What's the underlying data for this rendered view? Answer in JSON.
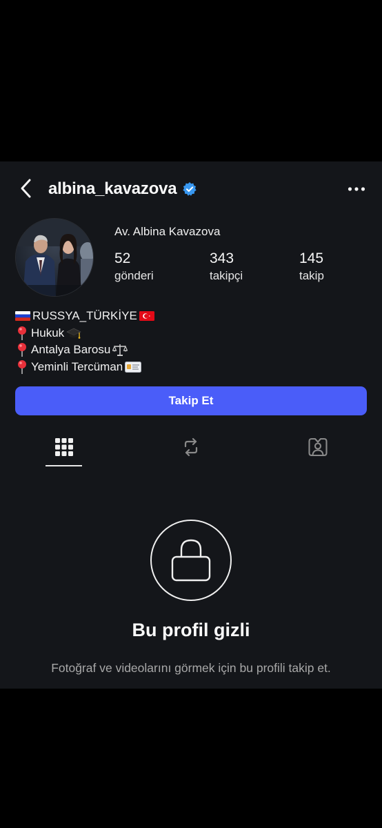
{
  "header": {
    "username": "albina_kavazova",
    "verified": true,
    "back_icon": "chevron-left-icon",
    "more_icon": "more-horizontal-icon"
  },
  "profile": {
    "display_name": "Av. Albina Kavazova",
    "stats": {
      "posts": {
        "value": "52",
        "label": "gönderi"
      },
      "followers": {
        "value": "343",
        "label": "takipçi"
      },
      "following": {
        "value": "145",
        "label": "takip"
      }
    },
    "bio": [
      {
        "prefix_icon": "russia-flag-icon",
        "text": "RUSSYA_TÜRKİYE",
        "suffix_icon": "turkey-flag-icon"
      },
      {
        "prefix_icon": "pin-icon",
        "text": "Hukuk",
        "suffix_icon": "graduation-cap-icon"
      },
      {
        "prefix_icon": "pin-icon",
        "text": "Antalya Barosu",
        "suffix_icon": "scales-icon"
      },
      {
        "prefix_icon": "pin-icon",
        "text": "Yeminli Tercüman",
        "suffix_icon": "id-card-icon"
      }
    ]
  },
  "actions": {
    "follow_label": "Takip Et"
  },
  "tabs": [
    {
      "icon": "grid-icon",
      "active": true
    },
    {
      "icon": "reposts-icon",
      "active": false
    },
    {
      "icon": "tagged-icon",
      "active": false
    }
  ],
  "private": {
    "icon": "lock-icon",
    "title": "Bu profil gizli",
    "description": "Fotoğraf ve videolarını görmek için bu profili takip et."
  },
  "colors": {
    "background": "#14161a",
    "accent": "#4a5df9",
    "verified": "#3897f0",
    "muted_text": "#a8a8a8"
  }
}
